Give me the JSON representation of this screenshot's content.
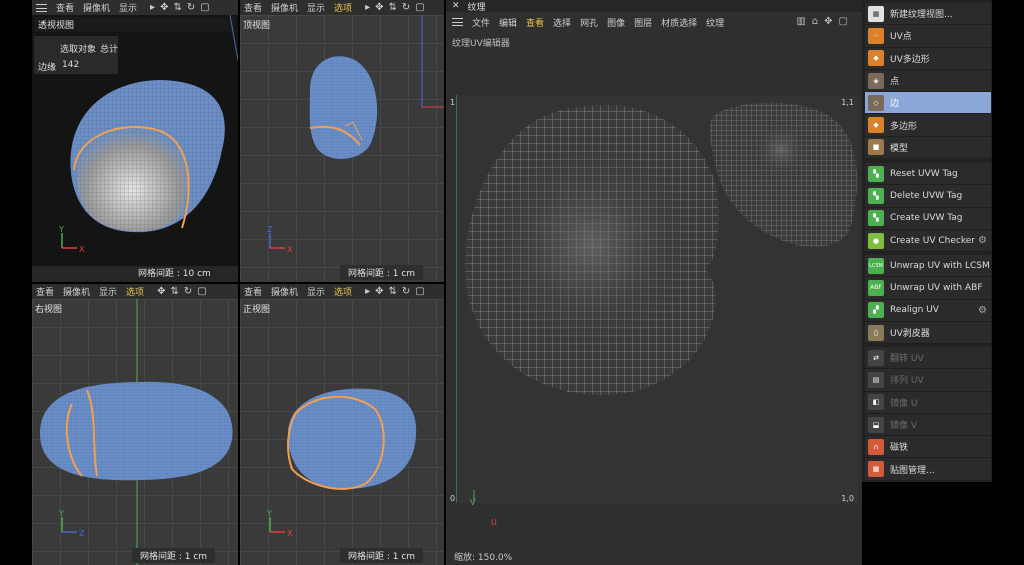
{
  "viewports": {
    "perspective": {
      "title": "透视视图",
      "menu": [
        "查看",
        "摄像机",
        "显示"
      ],
      "footer": "网格间距 : 10 cm",
      "info_label_1": "选取对象",
      "info_label_2": "总计",
      "info_row_label": "边缘",
      "info_row_value": "142"
    },
    "top": {
      "title": "顶视图",
      "menu": [
        "查看",
        "摄像机",
        "显示",
        "选项"
      ],
      "footer": "网格间距 : 1 cm"
    },
    "right": {
      "title": "右视图",
      "menu": [
        "查看",
        "摄像机",
        "显示",
        "选项"
      ],
      "footer": "网格间距 : 1 cm"
    },
    "front": {
      "title": "正视图",
      "menu": [
        "查看",
        "摄像机",
        "显示",
        "选项"
      ],
      "footer": "网格间距 : 1 cm"
    },
    "highlight_menu": "选项"
  },
  "uv_editor": {
    "window_title": "纹理",
    "menu": [
      "文件",
      "编辑",
      "查看",
      "选择",
      "网孔",
      "图像",
      "图层",
      "材质选择",
      "纹理"
    ],
    "active_menu": "查看",
    "subtitle": "纹理UV编辑器",
    "label_top_left": "1",
    "label_top_right": "1,1",
    "label_bottom_left": "0",
    "label_bottom_right": "1,0",
    "axis_v": "V",
    "axis_u": "U",
    "zoom": "缩放: 150.0%"
  },
  "tools": {
    "group1": [
      {
        "label": "新建纹理视图...",
        "icon": "new-texture-view-icon",
        "color": "#e0e0e0"
      },
      {
        "label": "UV点",
        "icon": "uv-points-icon",
        "color": "#d9822b"
      },
      {
        "label": "UV多边形",
        "icon": "uv-polygons-icon",
        "color": "#d9822b"
      },
      {
        "label": "点",
        "icon": "points-icon",
        "color": "#7a6a5a"
      },
      {
        "label": "边",
        "icon": "edges-icon",
        "color": "#7a6a5a",
        "active": true
      },
      {
        "label": "多边形",
        "icon": "polygons-icon",
        "color": "#d9822b"
      },
      {
        "label": "模型",
        "icon": "model-icon",
        "color": "#9a7a4a"
      }
    ],
    "group2": [
      {
        "label": "Reset UVW Tag",
        "icon": "reset-uvw-icon",
        "color": "#4caf50"
      },
      {
        "label": "Delete UVW Tag",
        "icon": "delete-uvw-icon",
        "color": "#4caf50"
      },
      {
        "label": "Create UVW Tag",
        "icon": "create-uvw-icon",
        "color": "#4caf50"
      },
      {
        "label": "Create UV Checker",
        "icon": "uv-checker-icon",
        "color": "#7fbf3f",
        "gear": true
      }
    ],
    "group3": [
      {
        "label": "Unwrap UV with LCSM",
        "icon": "lcsm-icon",
        "color": "#4caf50",
        "badge": "LCSM"
      },
      {
        "label": "Unwrap UV with ABF",
        "icon": "abf-icon",
        "color": "#4caf50",
        "badge": "ABF"
      },
      {
        "label": "Realign UV",
        "icon": "realign-uv-icon",
        "color": "#4caf50",
        "gear": true
      },
      {
        "label": "UV剥皮器",
        "icon": "uv-peeler-icon",
        "color": "#8a7a5a"
      }
    ],
    "group4": [
      {
        "label": "翻转 UV",
        "icon": "flip-uv-icon",
        "color": "#555",
        "disabled": true
      },
      {
        "label": "排列 UV",
        "icon": "arrange-uv-icon",
        "color": "#555",
        "disabled": true
      },
      {
        "label": "镜像 U",
        "icon": "mirror-u-icon",
        "color": "#555",
        "disabled": true
      },
      {
        "label": "镜像 V",
        "icon": "mirror-v-icon",
        "color": "#555",
        "disabled": true
      },
      {
        "label": "磁铁",
        "icon": "magnet-icon",
        "color": "#d35b3b"
      },
      {
        "label": "贴图管理...",
        "icon": "texture-manager-icon",
        "color": "#d35b3b"
      }
    ]
  },
  "colors": {
    "mesh_fill": "#6a8fc8",
    "seam": "#f0a050",
    "selection": "#8aa7d8"
  }
}
